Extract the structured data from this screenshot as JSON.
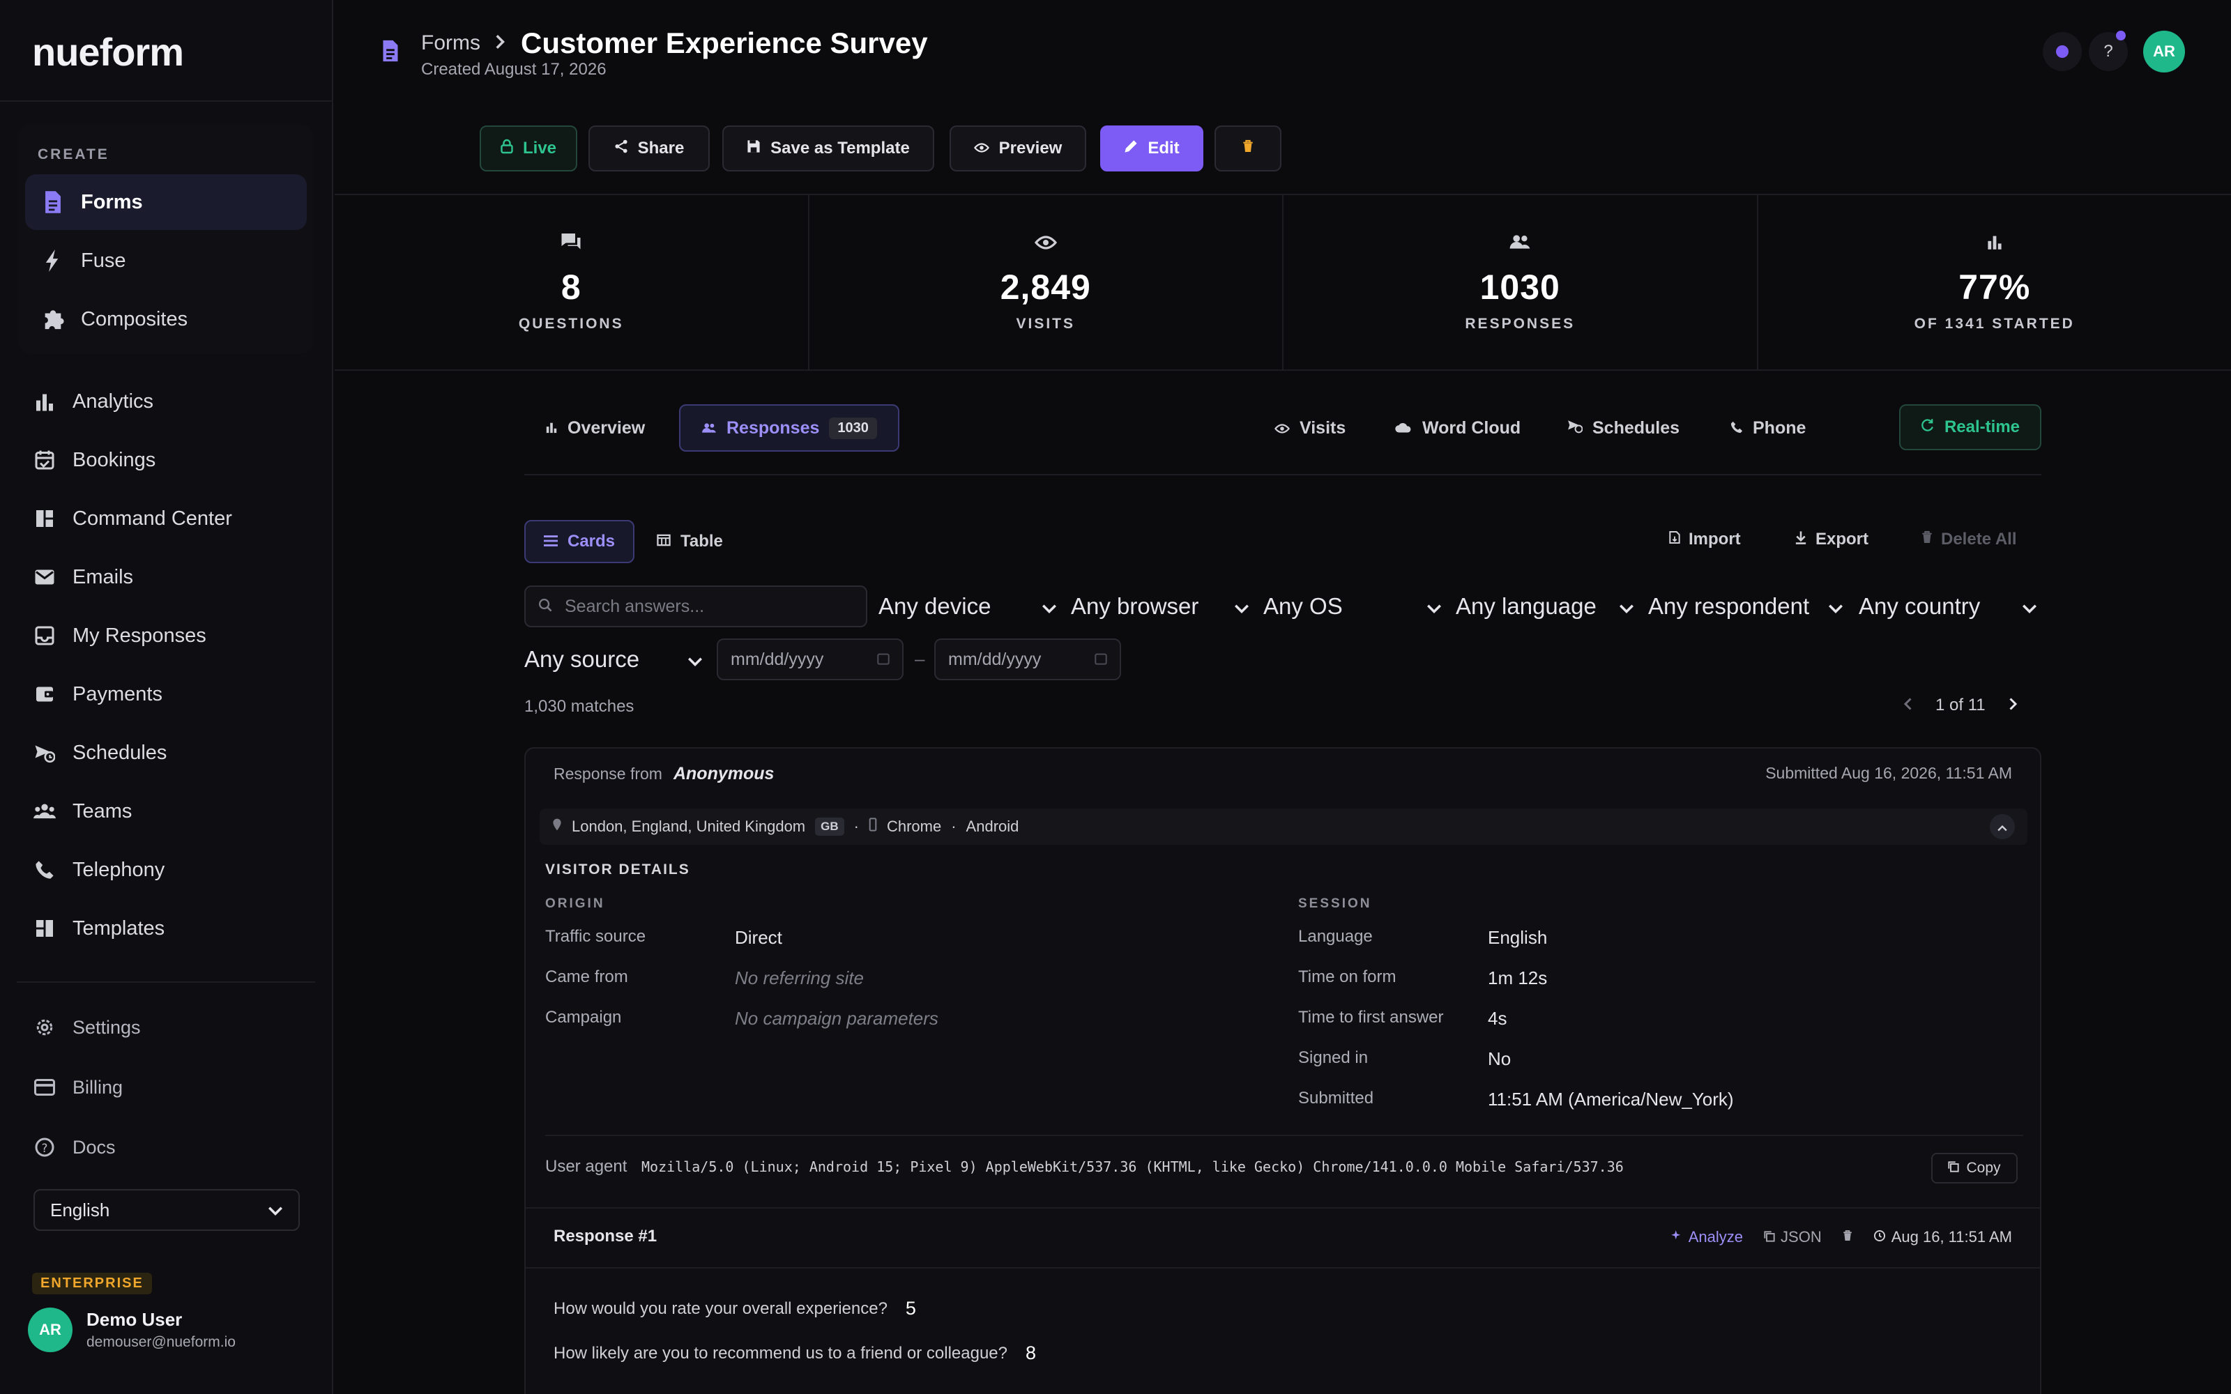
{
  "sidebar": {
    "logo": "nueform",
    "create_label": "CREATE",
    "create_items": [
      {
        "label": "Forms",
        "icon": "document-icon"
      },
      {
        "label": "Fuse",
        "icon": "bolt-icon"
      },
      {
        "label": "Composites",
        "icon": "puzzle-icon"
      }
    ],
    "items": [
      {
        "label": "Analytics",
        "icon": "bar-chart-icon"
      },
      {
        "label": "Bookings",
        "icon": "calendar-check-icon"
      },
      {
        "label": "Command Center",
        "icon": "dashboard-icon"
      },
      {
        "label": "Emails",
        "icon": "mail-check-icon"
      },
      {
        "label": "My Responses",
        "icon": "inbox-icon"
      },
      {
        "label": "Payments",
        "icon": "wallet-icon"
      },
      {
        "label": "Schedules",
        "icon": "schedule-send-icon"
      },
      {
        "label": "Teams",
        "icon": "group-icon"
      },
      {
        "label": "Telephony",
        "icon": "phone-icon"
      },
      {
        "label": "Templates",
        "icon": "grid-icon"
      }
    ],
    "footer_items": [
      {
        "label": "Settings",
        "icon": "gear-icon"
      },
      {
        "label": "Billing",
        "icon": "credit-card-icon"
      },
      {
        "label": "Docs",
        "icon": "help-circle-icon"
      }
    ],
    "language": "English",
    "plan_badge": "ENTERPRISE",
    "user": {
      "initials": "AR",
      "name": "Demo User",
      "email": "demouser@nueform.io"
    }
  },
  "header": {
    "breadcrumb": "Forms",
    "title": "Customer Experience Survey",
    "created": "Created August 17, 2026",
    "avatar_initials": "AR",
    "help": "?"
  },
  "toolbar": {
    "live": "Live",
    "share": "Share",
    "save_template": "Save as Template",
    "preview": "Preview",
    "edit": "Edit"
  },
  "stats": [
    {
      "value": "8",
      "label": "QUESTIONS",
      "icon": "chat-icon"
    },
    {
      "value": "2,849",
      "label": "VISITS",
      "icon": "eye-icon"
    },
    {
      "value": "1030",
      "label": "RESPONSES",
      "icon": "people-icon"
    },
    {
      "value": "77%",
      "label": "OF 1341 STARTED",
      "icon": "bar-chart-icon"
    }
  ],
  "tabs": {
    "overview": "Overview",
    "responses": "Responses",
    "responses_count": "1030",
    "visits": "Visits",
    "word_cloud": "Word Cloud",
    "schedules": "Schedules",
    "phone": "Phone",
    "realtime": "Real-time"
  },
  "view": {
    "cards": "Cards",
    "table": "Table",
    "import": "Import",
    "export": "Export",
    "delete_all": "Delete All"
  },
  "filters": {
    "search_placeholder": "Search answers...",
    "device": "Any device",
    "browser": "Any browser",
    "os": "Any OS",
    "language": "Any language",
    "respondent": "Any respondent",
    "country": "Any country",
    "source": "Any source",
    "date_from": "mm/dd/yyyy",
    "date_to": "mm/dd/yyyy",
    "date_sep": "–"
  },
  "results": {
    "matches": "1,030 matches",
    "page": "1 of 11"
  },
  "response": {
    "from_label": "Response from",
    "from_name": "Anonymous",
    "submitted": "Submitted Aug 16, 2026, 11:51 AM",
    "location": "London, England, United Kingdom",
    "country_code": "GB",
    "dot": "·",
    "browser": "Chrome",
    "os": "Android",
    "visitor_title": "VISITOR DETAILS",
    "origin_title": "ORIGIN",
    "session_title": "SESSION",
    "origin": [
      {
        "k": "Traffic source",
        "v": "Direct"
      },
      {
        "k": "Came from",
        "v": "No referring site"
      },
      {
        "k": "Campaign",
        "v": "No campaign parameters"
      }
    ],
    "session": [
      {
        "k": "Language",
        "v": "English"
      },
      {
        "k": "Time on form",
        "v": "1m 12s"
      },
      {
        "k": "Time to first answer",
        "v": "4s"
      },
      {
        "k": "Signed in",
        "v": "No"
      },
      {
        "k": "Submitted",
        "v": "11:51 AM (America/New_York)"
      }
    ],
    "ua_label": "User agent",
    "ua": "Mozilla/5.0 (Linux; Android 15; Pixel 9) AppleWebKit/537.36 (KHTML, like Gecko) Chrome/141.0.0.0 Mobile Safari/537.36",
    "copy": "Copy",
    "number": "Response #1",
    "analyze": "Analyze",
    "json": "JSON",
    "time": "Aug 16, 11:51 AM",
    "answers": [
      {
        "q": "How would you rate your overall experience?",
        "a": "5"
      },
      {
        "q": "How likely are you to recommend us to a friend or colleague?",
        "a": "8"
      }
    ]
  },
  "colors": {
    "accent": "#7c5cf5",
    "live": "#2ec48f",
    "enterprise": "#f1a72c"
  }
}
